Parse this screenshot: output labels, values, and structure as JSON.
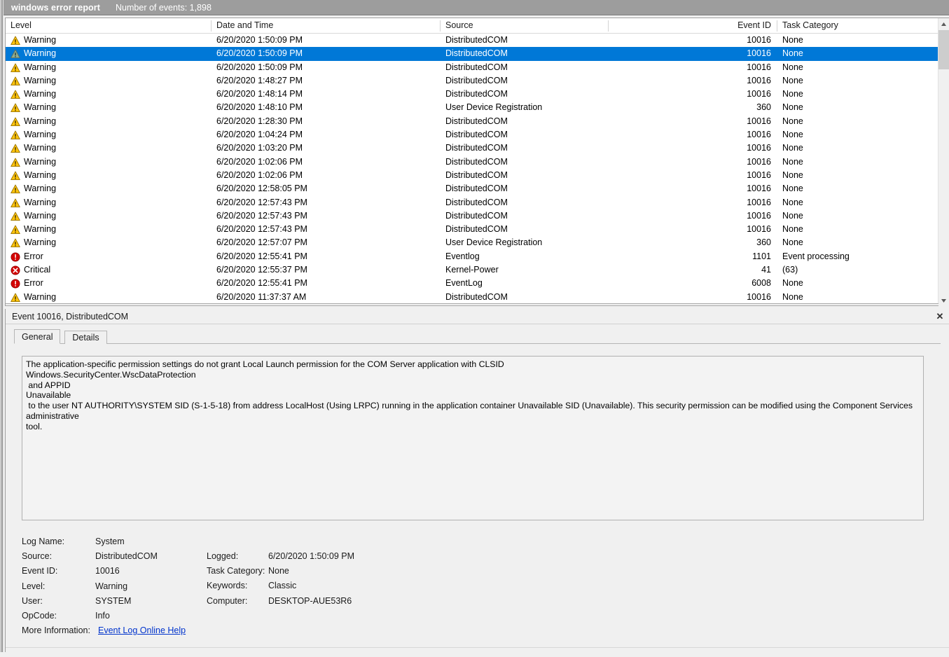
{
  "window": {
    "title": "windows error report",
    "events_count_label": "Number of events: 1,898",
    "close_icon": "close-icon"
  },
  "list": {
    "columns": [
      {
        "key": "level",
        "label": "Level"
      },
      {
        "key": "datetime",
        "label": "Date and Time"
      },
      {
        "key": "source",
        "label": "Source"
      },
      {
        "key": "event_id",
        "label": "Event ID"
      },
      {
        "key": "task_category",
        "label": "Task Category"
      }
    ],
    "rows": [
      {
        "level": "Warning",
        "icon": "warning-icon",
        "datetime": "6/20/2020 1:50:09 PM",
        "source": "DistributedCOM",
        "event_id": "10016",
        "task_category": "None",
        "selected": false
      },
      {
        "level": "Warning",
        "icon": "warning-icon",
        "datetime": "6/20/2020 1:50:09 PM",
        "source": "DistributedCOM",
        "event_id": "10016",
        "task_category": "None",
        "selected": true
      },
      {
        "level": "Warning",
        "icon": "warning-icon",
        "datetime": "6/20/2020 1:50:09 PM",
        "source": "DistributedCOM",
        "event_id": "10016",
        "task_category": "None",
        "selected": false
      },
      {
        "level": "Warning",
        "icon": "warning-icon",
        "datetime": "6/20/2020 1:48:27 PM",
        "source": "DistributedCOM",
        "event_id": "10016",
        "task_category": "None",
        "selected": false
      },
      {
        "level": "Warning",
        "icon": "warning-icon",
        "datetime": "6/20/2020 1:48:14 PM",
        "source": "DistributedCOM",
        "event_id": "10016",
        "task_category": "None",
        "selected": false
      },
      {
        "level": "Warning",
        "icon": "warning-icon",
        "datetime": "6/20/2020 1:48:10 PM",
        "source": "User Device Registration",
        "event_id": "360",
        "task_category": "None",
        "selected": false
      },
      {
        "level": "Warning",
        "icon": "warning-icon",
        "datetime": "6/20/2020 1:28:30 PM",
        "source": "DistributedCOM",
        "event_id": "10016",
        "task_category": "None",
        "selected": false
      },
      {
        "level": "Warning",
        "icon": "warning-icon",
        "datetime": "6/20/2020 1:04:24 PM",
        "source": "DistributedCOM",
        "event_id": "10016",
        "task_category": "None",
        "selected": false
      },
      {
        "level": "Warning",
        "icon": "warning-icon",
        "datetime": "6/20/2020 1:03:20 PM",
        "source": "DistributedCOM",
        "event_id": "10016",
        "task_category": "None",
        "selected": false
      },
      {
        "level": "Warning",
        "icon": "warning-icon",
        "datetime": "6/20/2020 1:02:06 PM",
        "source": "DistributedCOM",
        "event_id": "10016",
        "task_category": "None",
        "selected": false
      },
      {
        "level": "Warning",
        "icon": "warning-icon",
        "datetime": "6/20/2020 1:02:06 PM",
        "source": "DistributedCOM",
        "event_id": "10016",
        "task_category": "None",
        "selected": false
      },
      {
        "level": "Warning",
        "icon": "warning-icon",
        "datetime": "6/20/2020 12:58:05 PM",
        "source": "DistributedCOM",
        "event_id": "10016",
        "task_category": "None",
        "selected": false
      },
      {
        "level": "Warning",
        "icon": "warning-icon",
        "datetime": "6/20/2020 12:57:43 PM",
        "source": "DistributedCOM",
        "event_id": "10016",
        "task_category": "None",
        "selected": false
      },
      {
        "level": "Warning",
        "icon": "warning-icon",
        "datetime": "6/20/2020 12:57:43 PM",
        "source": "DistributedCOM",
        "event_id": "10016",
        "task_category": "None",
        "selected": false
      },
      {
        "level": "Warning",
        "icon": "warning-icon",
        "datetime": "6/20/2020 12:57:43 PM",
        "source": "DistributedCOM",
        "event_id": "10016",
        "task_category": "None",
        "selected": false
      },
      {
        "level": "Warning",
        "icon": "warning-icon",
        "datetime": "6/20/2020 12:57:07 PM",
        "source": "User Device Registration",
        "event_id": "360",
        "task_category": "None",
        "selected": false
      },
      {
        "level": "Error",
        "icon": "error-icon",
        "datetime": "6/20/2020 12:55:41 PM",
        "source": "Eventlog",
        "event_id": "1101",
        "task_category": "Event processing",
        "selected": false
      },
      {
        "level": "Critical",
        "icon": "critical-icon",
        "datetime": "6/20/2020 12:55:37 PM",
        "source": "Kernel-Power",
        "event_id": "41",
        "task_category": "(63)",
        "selected": false
      },
      {
        "level": "Error",
        "icon": "error-icon",
        "datetime": "6/20/2020 12:55:41 PM",
        "source": "EventLog",
        "event_id": "6008",
        "task_category": "None",
        "selected": false
      },
      {
        "level": "Warning",
        "icon": "warning-icon",
        "datetime": "6/20/2020 11:37:37 AM",
        "source": "DistributedCOM",
        "event_id": "10016",
        "task_category": "None",
        "selected": false
      }
    ],
    "scrollbar": {
      "up_arrow_icon": "chevron-up-icon",
      "down_arrow_icon": "chevron-down-icon"
    }
  },
  "detail": {
    "header_title": "Event 10016, DistributedCOM",
    "tabs": [
      {
        "label": "General",
        "active": true
      },
      {
        "label": "Details",
        "active": false
      }
    ],
    "description_lines": [
      "The application-specific permission settings do not grant Local Launch permission for the COM Server application with CLSID",
      "Windows.SecurityCenter.WscDataProtection",
      " and APPID",
      "Unavailable",
      " to the user NT AUTHORITY\\SYSTEM SID (S-1-5-18) from address LocalHost (Using LRPC) running in the application container Unavailable SID (Unavailable). This security permission can be modified using the Component Services administrative",
      "tool."
    ],
    "meta_left": [
      {
        "label": "Log Name:",
        "value": "System"
      },
      {
        "label": "Source:",
        "value": "DistributedCOM"
      },
      {
        "label": "Event ID:",
        "value": "10016"
      },
      {
        "label": "Level:",
        "value": "Warning"
      },
      {
        "label": "User:",
        "value": "SYSTEM"
      },
      {
        "label": "OpCode:",
        "value": "Info"
      }
    ],
    "meta_right": [
      {
        "label": "Logged:",
        "value": "6/20/2020 1:50:09 PM"
      },
      {
        "label": "Task Category:",
        "value": "None"
      },
      {
        "label": "Keywords:",
        "value": "Classic"
      },
      {
        "label": "Computer:",
        "value": "DESKTOP-AUE53R6"
      }
    ],
    "more_information_label": "More Information:",
    "more_information_link": "Event Log Online Help"
  },
  "colors": {
    "caption_bg": "#9d9d9d",
    "selection_blue": "#0078d7",
    "warning_yellow": "#ffc40c",
    "error_red": "#d40000",
    "link_blue": "#0033cc"
  }
}
